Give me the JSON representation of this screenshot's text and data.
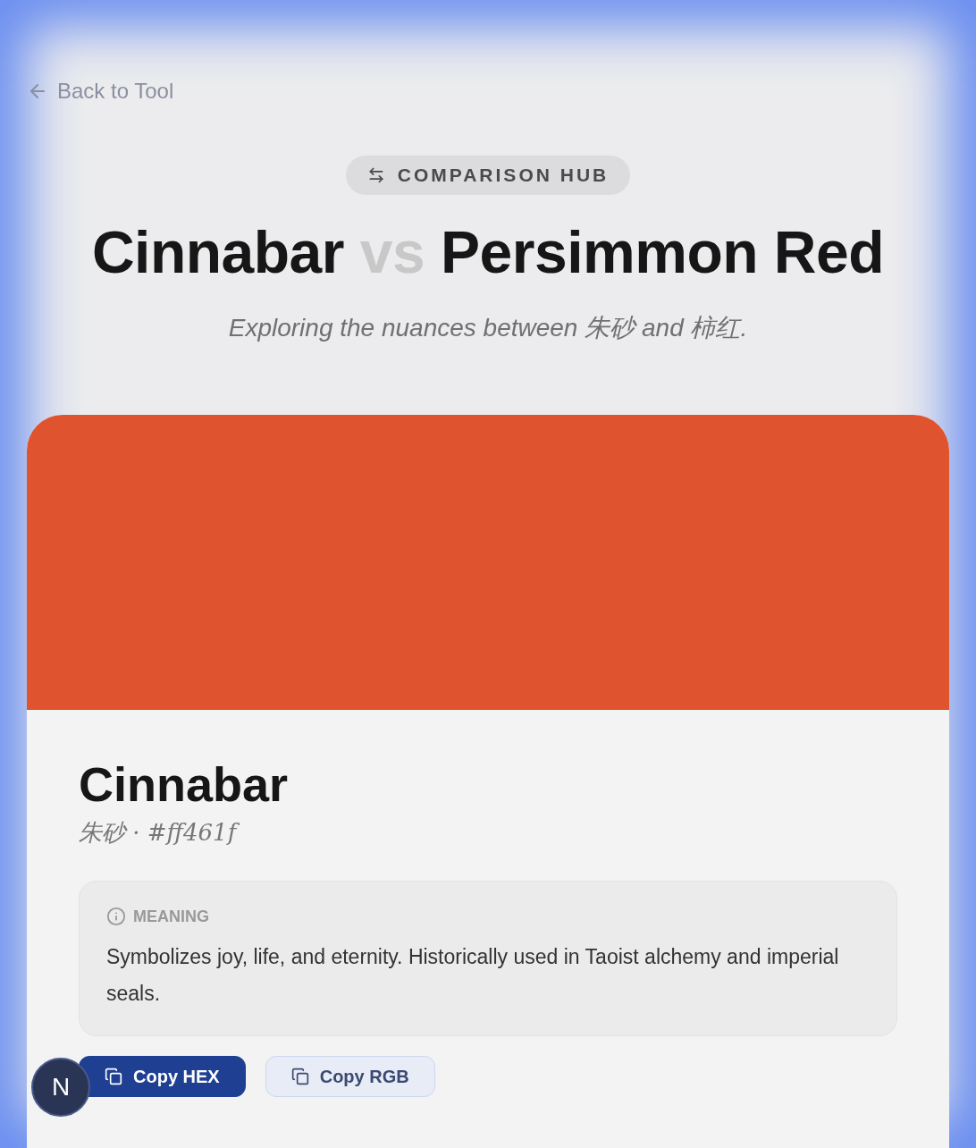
{
  "back_link": {
    "label": "Back to Tool"
  },
  "badge": {
    "label": "COMPARISON HUB"
  },
  "title": {
    "left": "Cinnabar",
    "separator": "vs",
    "right": "Persimmon Red"
  },
  "subtitle": "Exploring the nuances between 朱砂 and 柿红.",
  "card": {
    "color": "#e0532f",
    "name": "Cinnabar",
    "details": "朱砂 · #ff461f",
    "meaning": {
      "label": "MEANING",
      "text": "Symbolizes joy, life, and eternity. Historically used in Taoist alchemy and imperial seals."
    },
    "buttons": [
      {
        "label": "Copy HEX",
        "kind": "primary"
      },
      {
        "label": "Copy RGB",
        "kind": "secondary"
      }
    ]
  },
  "avatar": {
    "letter": "N"
  }
}
